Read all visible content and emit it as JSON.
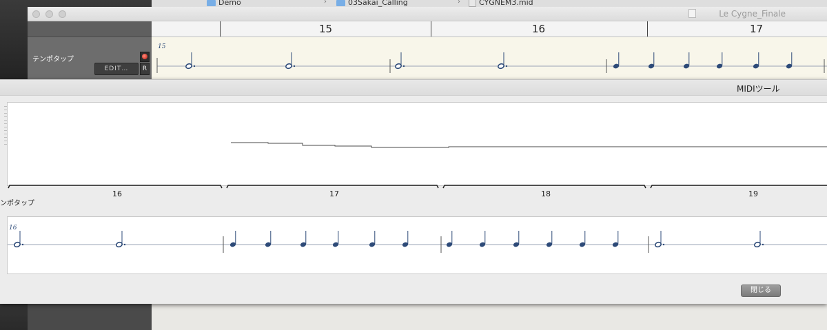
{
  "finder": {
    "crumbs": [
      "Demo",
      "03Sakai_Calling",
      "CYGNEM3.mid"
    ],
    "separators": [
      "›",
      "›",
      "›"
    ]
  },
  "main_window": {
    "title": "Le Cygne_Finale",
    "track": {
      "name": "テンポタップ",
      "edit_label": "EDIT…",
      "rec_label": "R"
    },
    "ruler": {
      "bars": [
        "15",
        "16",
        "17"
      ]
    },
    "score": {
      "measure_number": "15"
    }
  },
  "midi_tool": {
    "title": "MIDIツール",
    "measures": [
      "16",
      "17",
      "18",
      "19"
    ],
    "track_label": "ンポタップ",
    "score_measure_number": "16",
    "close_label": "閉じる"
  },
  "colors": {
    "note": "#2d4a78",
    "tempo_line": "#4a4a4a",
    "score_bg": "#f8f6ea",
    "led": "#d62a1a"
  }
}
